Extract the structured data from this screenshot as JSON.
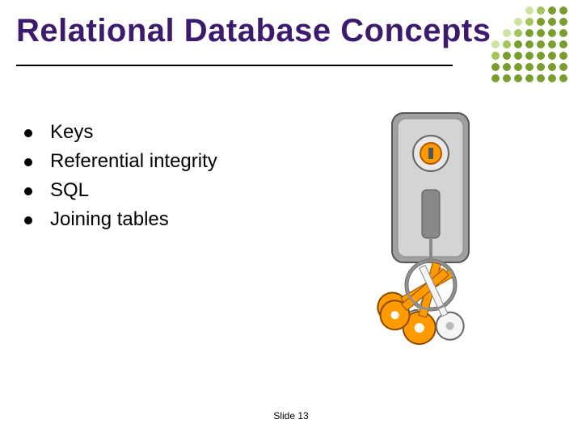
{
  "title": "Relational Database Concepts",
  "bullets": {
    "b0": "Keys",
    "b1": "Referential integrity",
    "b2": "SQL",
    "b3": "Joining tables"
  },
  "footer": "Slide 13",
  "colors": {
    "title": "#3c1a6e",
    "dots_dark": "#7a9e2e",
    "dots_mid": "#a3c55a",
    "dots_light": "#cfe3a3"
  },
  "clipart": "keys-and-lock-illustration"
}
